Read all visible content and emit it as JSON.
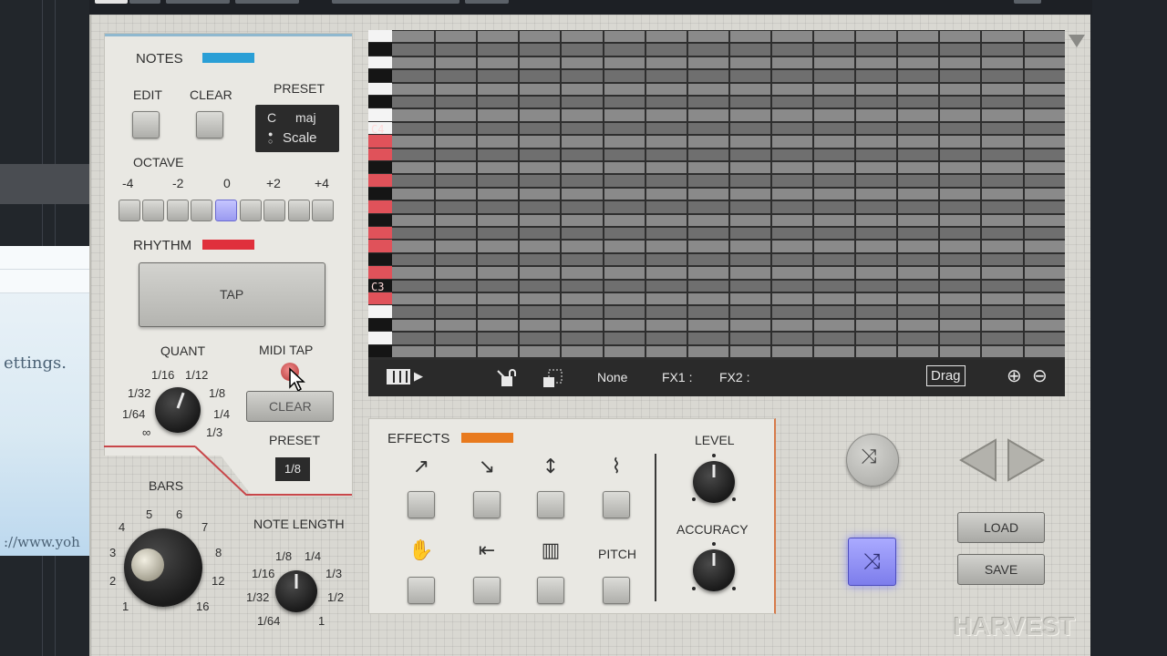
{
  "host": {
    "browser_text_1": "ettings.",
    "browser_text_2": "://www.yoh"
  },
  "notes": {
    "title": "NOTES",
    "color": "#2a9fd6",
    "edit_label": "EDIT",
    "clear_label": "CLEAR",
    "preset_label": "PRESET",
    "preset_key": "C",
    "preset_mode": "maj",
    "preset_scale": "Scale",
    "octave_label": "OCTAVE",
    "octave_values": [
      "-4",
      "-2",
      "0",
      "+2",
      "+4"
    ]
  },
  "rhythm": {
    "title": "RHYTHM",
    "color": "#e0303c",
    "tap_label": "TAP",
    "quant_label": "QUANT",
    "quant_values": [
      "1/16",
      "1/12",
      "1/32",
      "1/8",
      "1/64",
      "1/4",
      "∞",
      "1/3"
    ],
    "midi_tap_label": "MIDI TAP",
    "clear_label": "CLEAR",
    "preset_label": "PRESET",
    "preset_value": "1/8"
  },
  "bars": {
    "label": "BARS",
    "values": [
      "5",
      "6",
      "7",
      "4",
      "8",
      "3",
      "2",
      "12",
      "1",
      "16"
    ]
  },
  "note_length": {
    "label": "NOTE LENGTH",
    "values": [
      "1/8",
      "1/4",
      "1/16",
      "1/3",
      "1/32",
      "1/2",
      "1/64",
      "1"
    ]
  },
  "roll": {
    "c4_label": "C4",
    "c3_label": "C3",
    "none_label": "None",
    "fx1_label": "FX1 :",
    "fx2_label": "FX2 :",
    "drag_label": "Drag",
    "play_glyph": "▶",
    "zoom_in_glyph": "⊕",
    "zoom_out_glyph": "⊖"
  },
  "effects": {
    "title": "EFFECTS",
    "color": "#e87a1e",
    "pitch_label": "PITCH",
    "level_label": "LEVEL",
    "accuracy_label": "ACCURACY",
    "icons": [
      "↗",
      "↘",
      "↕",
      "⌇",
      "✋",
      "⇤",
      "▥"
    ]
  },
  "right": {
    "load_label": "LOAD",
    "save_label": "SAVE",
    "shuffle_glyph": "⤨",
    "logo_text": "HARVEST"
  }
}
